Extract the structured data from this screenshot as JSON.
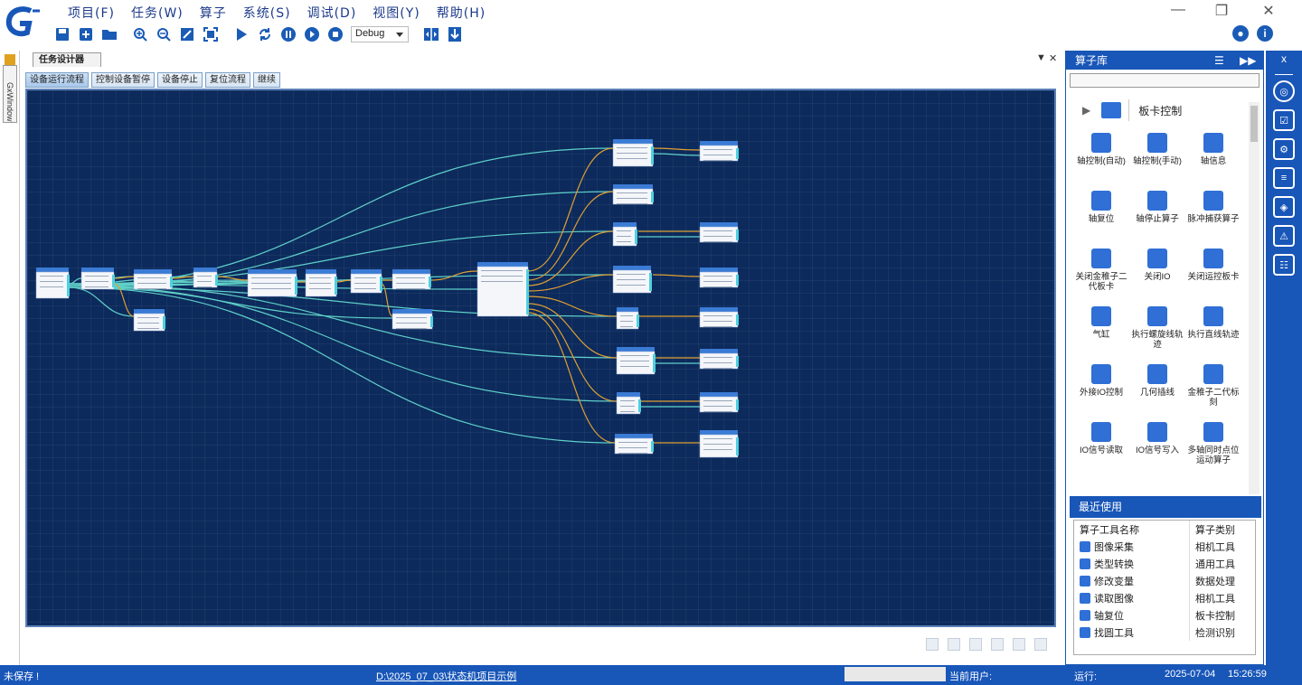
{
  "menu": {
    "items": [
      "项目(F)",
      "任务(W)",
      "算子",
      "系统(S)",
      "调试(D)",
      "视图(Y)",
      "帮助(H)"
    ]
  },
  "toolbar": {
    "debug_value": "Debug"
  },
  "left_strip": {
    "label": "GxWindow"
  },
  "document": {
    "tab_title": "任务设计器",
    "subtabs": [
      "设备运行流程",
      "控制设备暂停",
      "设备停止",
      "复位流程",
      "继续"
    ]
  },
  "right_panel": {
    "title": "算子库",
    "close_label": "x",
    "category_label": "板卡控制",
    "operators": [
      {
        "label": "轴控制(自动)",
        "icon": "axis-auto-icon"
      },
      {
        "label": "轴控制(手动)",
        "icon": "axis-manual-icon"
      },
      {
        "label": "轴信息",
        "icon": "axis-info-icon"
      },
      {
        "label": "轴复位",
        "icon": "axis-reset-icon"
      },
      {
        "label": "轴停止算子",
        "icon": "axis-stop-icon"
      },
      {
        "label": "脉冲捕获算子",
        "icon": "pulse-capture-icon"
      },
      {
        "label": "关闭金稚子二代板卡",
        "icon": "close-board-icon"
      },
      {
        "label": "关闭IO",
        "icon": "close-io-icon"
      },
      {
        "label": "关闭运控板卡",
        "icon": "close-motion-icon"
      },
      {
        "label": "气缸",
        "icon": "cylinder-icon"
      },
      {
        "label": "执行螺旋线轨迹",
        "icon": "spiral-icon"
      },
      {
        "label": "执行直线轨迹",
        "icon": "line-track-icon"
      },
      {
        "label": "外接IO控制",
        "icon": "external-io-icon"
      },
      {
        "label": "几何插线",
        "icon": "geometry-icon"
      },
      {
        "label": "金稚子二代标刻",
        "icon": "marking-icon"
      },
      {
        "label": "IO信号读取",
        "icon": "io-read-icon"
      },
      {
        "label": "IO信号写入",
        "icon": "io-write-icon"
      },
      {
        "label": "多轴同时点位运动算子",
        "icon": "multi-axis-icon"
      }
    ]
  },
  "recent": {
    "title": "最近使用",
    "headers": [
      "算子工具名称",
      "算子类别"
    ],
    "rows": [
      {
        "name": "图像采集",
        "category": "相机工具"
      },
      {
        "name": "类型转换",
        "category": "通用工具"
      },
      {
        "name": "修改变量",
        "category": "数据处理"
      },
      {
        "name": "读取图像",
        "category": "相机工具"
      },
      {
        "name": "轴复位",
        "category": "板卡控制"
      },
      {
        "name": "找圆工具",
        "category": "检测识别"
      }
    ]
  },
  "statusbar": {
    "save_state": "未保存 !",
    "project_path": "D:\\2025_07_03\\状态机项目示例",
    "current_user_label": "当前用户:",
    "run_label": "运行:",
    "date": "2025-07-04",
    "time": "15:26:59"
  },
  "colors": {
    "accent": "#1856b8",
    "canvas_bg": "#0c2a5c",
    "wire_orange": "#e0a030",
    "wire_cyan": "#5fd0c8"
  }
}
